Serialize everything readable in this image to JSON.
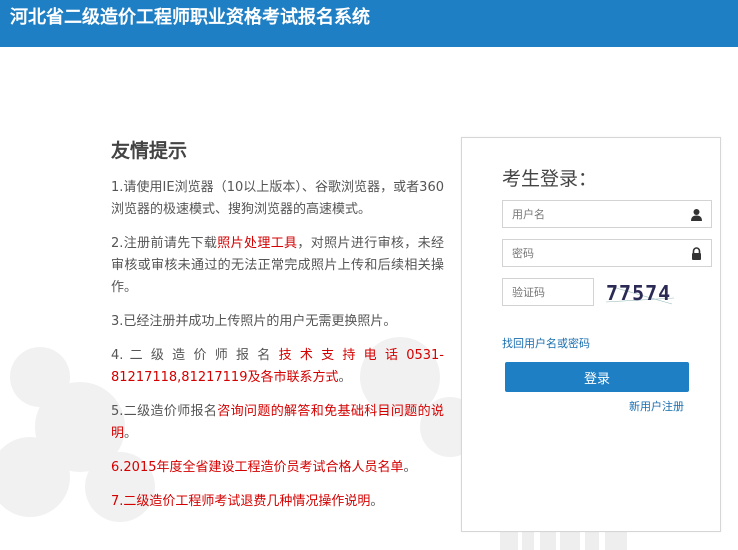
{
  "header": {
    "title": "河北省二级造价工程师职业资格考试报名系统"
  },
  "colors": {
    "brand": "#1f7fc4",
    "link_red": "#d40000",
    "link_blue": "#1a6fb0"
  },
  "tips": {
    "heading": "友情提示",
    "items": [
      {
        "prefix": "1.请使用IE浏览器（10以上版本）、谷歌浏览器，或者360浏览器的极速模式、搜狗浏览器的高速模式。"
      },
      {
        "prefix": "2.注册前请先下载",
        "link": "照片处理工具",
        "suffix": "，对照片进行审核，未经审核或审核未通过的无法正常完成照片上传和后续相关操作。"
      },
      {
        "prefix": "3.已经注册并成功上传照片的用户无需更换照片。"
      },
      {
        "prefix": "4. 二 级 造 价 师 报 名 ",
        "link": "技 术 支 持 电 话 0531-81217118,81217119及各市联系方式",
        "suffix": "。"
      },
      {
        "prefix": "5.二级造价师报名",
        "link": "咨询问题的解答和免基础科目问题的说明",
        "suffix": "。"
      },
      {
        "prefix": "6.",
        "link": "2015年度全省建设工程造价员考试合格人员名单",
        "suffix": "。"
      },
      {
        "prefix": "7.",
        "link": "二级造价工程师考试退费几种情况操作说明",
        "suffix": "。"
      }
    ]
  },
  "login": {
    "title": "考生登录：",
    "username_placeholder": "用户名",
    "password_placeholder": "密码",
    "captcha_placeholder": "验证码",
    "captcha_text": "77574",
    "forgot_link": "找回用户名或密码",
    "submit_label": "登录",
    "register_link": "新用户注册",
    "username_icon": "user-icon",
    "password_icon": "lock-icon"
  }
}
